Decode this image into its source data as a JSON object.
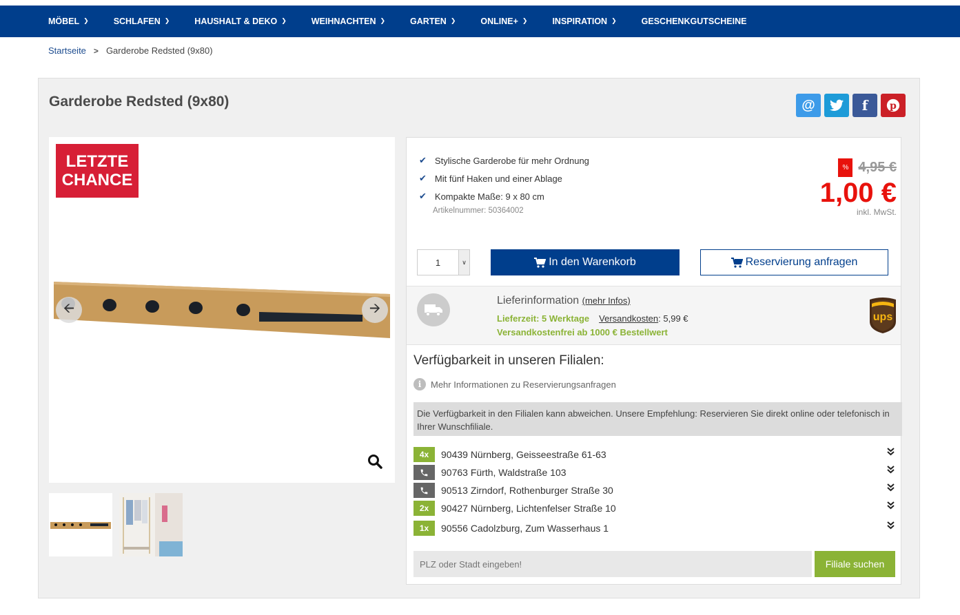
{
  "nav": {
    "items": [
      {
        "label": "MÖBEL"
      },
      {
        "label": "SCHLAFEN"
      },
      {
        "label": "HAUSHALT & DEKO"
      },
      {
        "label": "WEIHNACHTEN"
      },
      {
        "label": "GARTEN"
      },
      {
        "label": "ONLINE+"
      },
      {
        "label": "INSPIRATION"
      },
      {
        "label": "GESCHENKGUTSCHEINE"
      }
    ]
  },
  "breadcrumb": {
    "home": "Startseite",
    "current": "Garderobe Redsted (9x80)"
  },
  "product": {
    "title": "Garderobe Redsted (9x80)",
    "badge_line1": "LETZTE",
    "badge_line2": "CHANCE",
    "features": [
      "Stylische Garderobe für mehr Ordnung",
      "Mit fünf Haken und einer Ablage",
      "Kompakte Maße: 9 x 80 cm"
    ],
    "article_number": "Artikelnummer: 50364002",
    "sale_badge": "%",
    "old_price": "4,95 €",
    "new_price": "1,00 €",
    "tax_note": "inkl. MwSt.",
    "quantity": "1",
    "cart_button": "In den Warenkorb",
    "reserve_button": "Reservierung anfragen"
  },
  "delivery": {
    "title": "Lieferinformation",
    "more": "(mehr Infos)",
    "time": "Lieferzeit: 5 Werktage",
    "shipping_label": "Versandkosten",
    "shipping_value": ": 5,99 €",
    "free_shipping": "Versandkostenfrei ab 1000 € Bestellwert"
  },
  "availability": {
    "title": "Verfügbarkeit in unseren Filialen:",
    "more_info": "Mehr Informationen zu Reservierungsanfragen",
    "notice": "Die Verfügbarkeit in den Filialen kann abweichen. Unsere Empfehlung: Reservieren Sie direkt online oder telefonisch in Ihrer Wunschfiliale.",
    "branches": [
      {
        "badge": "4x",
        "type": "stock",
        "name": "90439 Nürnberg, Geisseestraße 61-63"
      },
      {
        "badge": "phone",
        "type": "phone",
        "name": "90763 Fürth, Waldstraße 103"
      },
      {
        "badge": "phone",
        "type": "phone",
        "name": "90513 Zirndorf, Rothenburger Straße 30"
      },
      {
        "badge": "2x",
        "type": "stock",
        "name": "90427 Nürnberg, Lichtenfelser Straße 10"
      },
      {
        "badge": "1x",
        "type": "stock",
        "name": "90556 Cadolzburg, Zum Wasserhaus 1"
      }
    ],
    "search_placeholder": "PLZ oder Stadt eingeben!",
    "search_button": "Filiale suchen"
  },
  "colors": {
    "nav": "#003e8c",
    "price": "#e8120c",
    "green": "#8bb336",
    "badge": "#d71f36"
  }
}
